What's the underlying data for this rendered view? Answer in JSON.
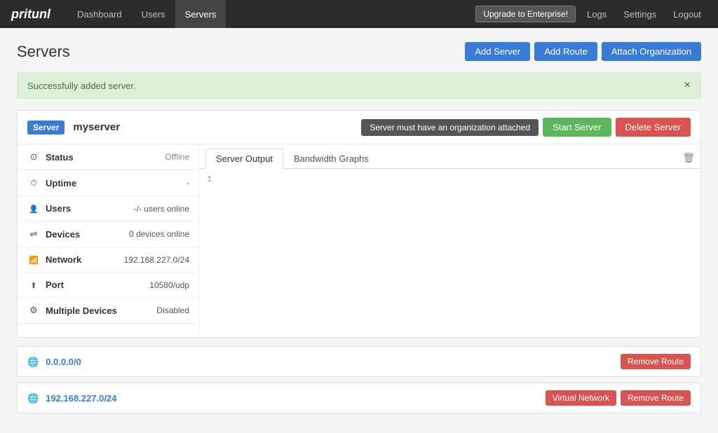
{
  "navbar": {
    "brand": "pritunl",
    "links": [
      {
        "label": "Dashboard",
        "active": false
      },
      {
        "label": "Users",
        "active": false
      },
      {
        "label": "Servers",
        "active": true
      }
    ],
    "upgrade_label": "Upgrade to Enterprise!",
    "right_links": [
      "Logs",
      "Settings",
      "Logout"
    ]
  },
  "page": {
    "title": "Servers"
  },
  "header_buttons": {
    "add_server": "Add Server",
    "add_route": "Add Route",
    "attach_org": "Attach Organization"
  },
  "alert": {
    "message": "Successfully added server.",
    "close": "×"
  },
  "server": {
    "badge": "Server",
    "name": "myserver",
    "status_hint": "Server must have an organization attached",
    "start_label": "Start Server",
    "delete_label": "Delete Server",
    "stats": [
      {
        "icon": "status-icon",
        "label": "Status",
        "value": "Offline"
      },
      {
        "icon": "uptime-icon",
        "label": "Uptime",
        "value": "-"
      },
      {
        "icon": "users-icon",
        "label": "Users",
        "value": "-/- users online"
      },
      {
        "icon": "devices-icon",
        "label": "Devices",
        "value": "0 devices online"
      },
      {
        "icon": "network-icon",
        "label": "Network",
        "value": "192.168.227.0/24"
      },
      {
        "icon": "port-icon",
        "label": "Port",
        "value": "10580/udp"
      },
      {
        "icon": "multidevices-icon",
        "label": "Multiple Devices",
        "value": "Disabled"
      }
    ],
    "tabs": [
      {
        "label": "Server Output",
        "active": true
      },
      {
        "label": "Bandwidth Graphs",
        "active": false
      }
    ],
    "output_line": "1"
  },
  "routes": [
    {
      "name": "0.0.0.0/0",
      "buttons": [
        {
          "label": "Remove Route",
          "type": "remove"
        }
      ]
    },
    {
      "name": "192.168.227.0/24",
      "buttons": [
        {
          "label": "Virtual Network",
          "type": "virtual"
        },
        {
          "label": "Remove Route",
          "type": "remove"
        }
      ]
    }
  ]
}
